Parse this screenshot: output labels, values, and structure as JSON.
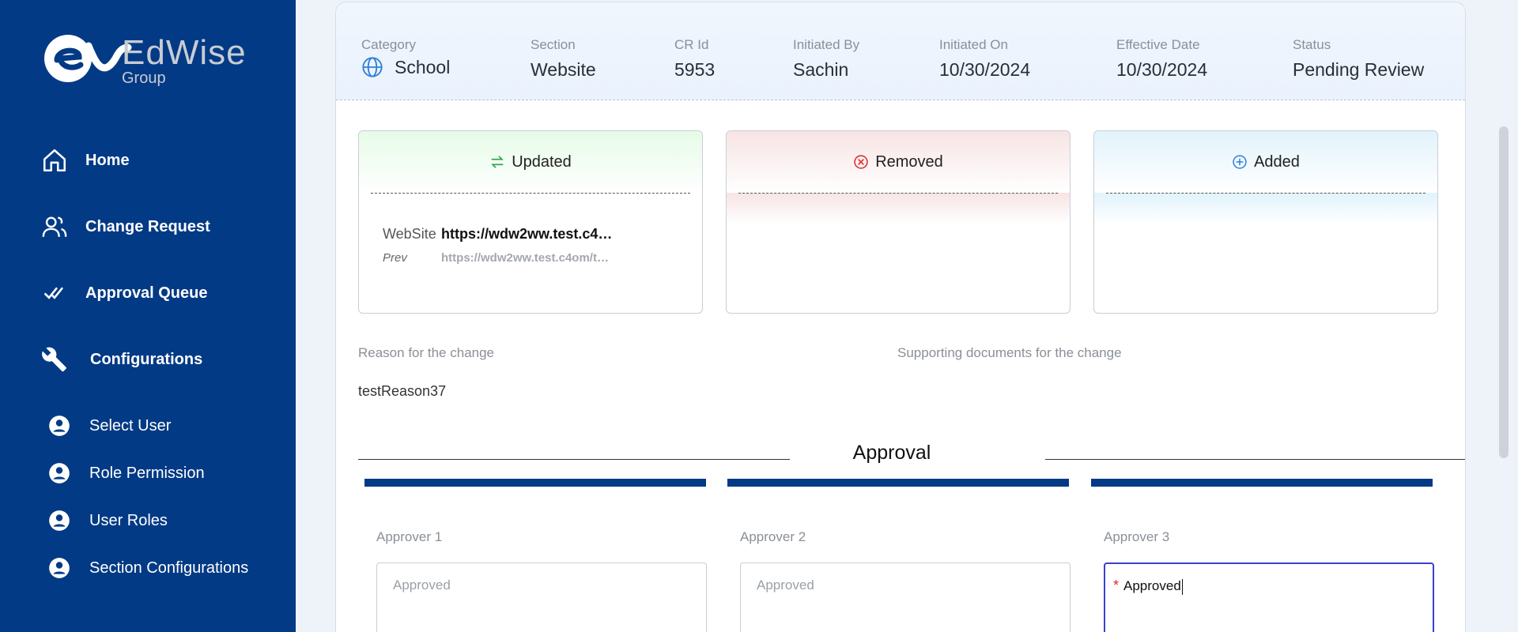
{
  "brand": {
    "name": "EdWise",
    "suffix": "Group"
  },
  "sidebar": {
    "items": [
      {
        "label": "Home",
        "icon": "home-icon"
      },
      {
        "label": "Change Request",
        "icon": "users-icon"
      },
      {
        "label": "Approval Queue",
        "icon": "double-check-icon"
      },
      {
        "label": "Configurations",
        "icon": "wrench-icon"
      }
    ],
    "sub_items": [
      {
        "label": "Select User",
        "icon": "account-circle-icon"
      },
      {
        "label": "Role Permission",
        "icon": "account-circle-icon"
      },
      {
        "label": "User Roles",
        "icon": "account-circle-icon"
      },
      {
        "label": "Section Configurations",
        "icon": "account-circle-icon"
      }
    ]
  },
  "meta": {
    "category": {
      "label": "Category",
      "value": "School",
      "icon": "globe-icon"
    },
    "section": {
      "label": "Section",
      "value": "Website"
    },
    "cr_id": {
      "label": "CR Id",
      "value": "5953"
    },
    "initiated_by": {
      "label": "Initiated By",
      "value": "Sachin"
    },
    "initiated_on": {
      "label": "Initiated On",
      "value": "10/30/2024"
    },
    "effective_date": {
      "label": "Effective Date",
      "value": "10/30/2024"
    },
    "status": {
      "label": "Status",
      "value": "Pending Review"
    }
  },
  "diff": {
    "updated": {
      "title": "Updated",
      "icon": "swap-arrows-icon",
      "field_label": "WebSite",
      "field_value": "https://wdw2ww.test.c4…",
      "prev_label": "Prev",
      "prev_value": "https://wdw2ww.test.c4om/t…"
    },
    "removed": {
      "title": "Removed",
      "icon": "circle-x-icon"
    },
    "added": {
      "title": "Added",
      "icon": "circle-plus-icon"
    }
  },
  "reason": {
    "label": "Reason for the change",
    "value": "testReason37"
  },
  "documents": {
    "label": "Supporting documents for the change"
  },
  "approval": {
    "title": "Approval",
    "approvers": [
      {
        "label": "Approver 1",
        "value": "Approved"
      },
      {
        "label": "Approver 2",
        "value": "Approved"
      },
      {
        "label": "Approver 3",
        "value": "Approved",
        "required_mark": "*"
      }
    ]
  },
  "colors": {
    "sidebar": "#033a85",
    "accent_bar": "#033a85",
    "active_border": "#3a3fcf"
  }
}
